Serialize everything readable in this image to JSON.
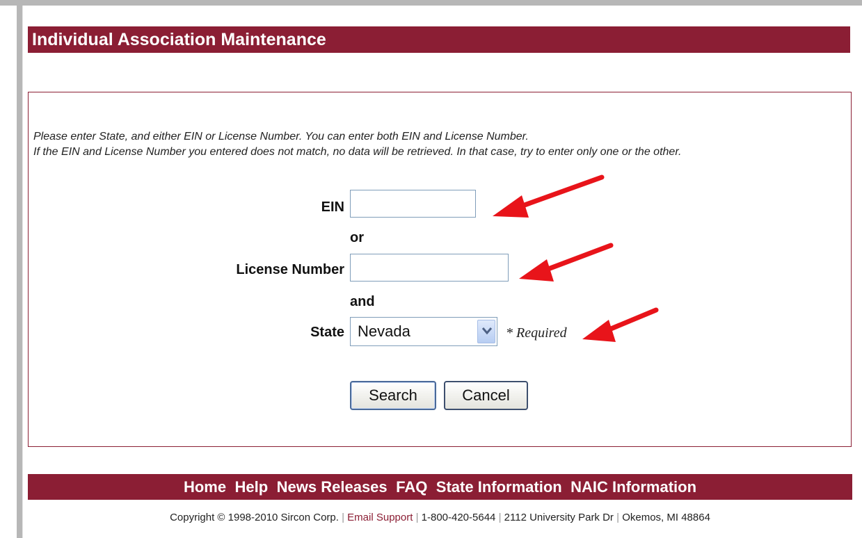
{
  "page": {
    "title": "Individual Association Maintenance"
  },
  "instructions": {
    "line1": "Please enter State, and either EIN or License Number. You can enter both EIN and License Number.",
    "line2": "If the EIN and License Number you entered does not match, no data will be retrieved. In that case, try to enter only one or the other."
  },
  "form": {
    "ein_label": "EIN",
    "ein_value": "",
    "or_text": "or",
    "license_label": "License Number",
    "license_value": "",
    "and_text": "and",
    "state_label": "State",
    "state_value": "Nevada",
    "required_note": "* Required",
    "search_label": "Search",
    "cancel_label": "Cancel"
  },
  "footer": {
    "nav": [
      "Home",
      "Help",
      "News Releases",
      "FAQ",
      "State Information",
      "NAIC Information"
    ],
    "copyright": "Copyright © 1998-2010 Sircon Corp.",
    "email_link": "Email Support",
    "phone": "1-800-420-5644",
    "address": "2112 University Park Dr",
    "city": "Okemos, MI 48864"
  },
  "colors": {
    "brand": "#8b1e34",
    "annotation_arrow": "#e8141a"
  },
  "annotations": [
    "red-arrow-icon",
    "red-arrow-icon",
    "red-arrow-icon"
  ]
}
